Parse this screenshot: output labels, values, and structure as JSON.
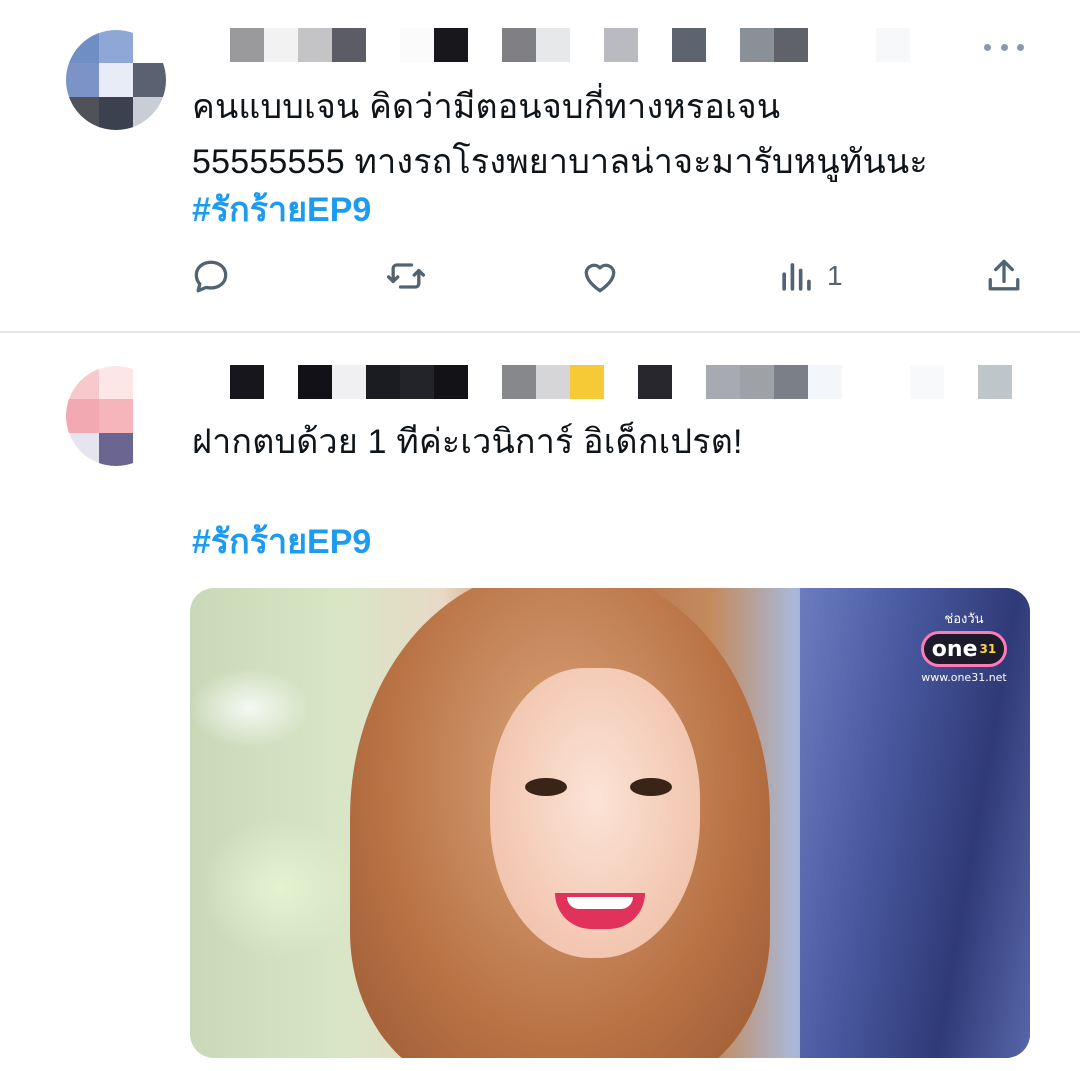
{
  "tweets": [
    {
      "text_lines": [
        "คนแบบเจน คิดว่ามีตอนจบกี่ทางหรอเจน",
        "55555555 ทางรถโรงพยาบาลน่าจะมารับหนูทันนะ"
      ],
      "hashtag": "#รักร้ายEP9",
      "views_count": "1",
      "avatar_pixels": [
        "#6f8fc4",
        "#8ea7d6",
        "#ffffff",
        "#7b93c6",
        "#e8ecf7",
        "#5a6170",
        "#4f5258",
        "#3c4150",
        "#c8cdd6"
      ],
      "name_pixels": [
        "#ffffff",
        "#9a9a9c",
        "#f2f2f2",
        "#c4c4c6",
        "#5c5c66",
        "#ffffff",
        "#fbfbfb",
        "#17171c",
        "#ffffff",
        "#7f7f84",
        "#e6e8ea",
        "#ffffff",
        "#b9bbc0",
        "#ffffff",
        "#5d6470",
        "#ffffff",
        "#8a9098",
        "#5f6268",
        "#ffffff",
        "#ffffff",
        "#f6f8fa",
        "#ffffff",
        "#ffffff",
        "#ffffff"
      ]
    },
    {
      "text_line": "ฝากตบด้วย 1 ทีค่ะเวนิการ์ อิเด็กเปรต!",
      "hashtag": "#รักร้ายEP9",
      "avatar_pixels": [
        "#f6c9cc",
        "#fde6e6",
        "#ffffff",
        "#f2a9b2",
        "#f5b5bb",
        "#ffffff",
        "#e6e4ee",
        "#6b6592",
        "#ffffff"
      ],
      "name_pixels": [
        "#ffffff",
        "#16161c",
        "#ffffff",
        "#111117",
        "#f0f0f2",
        "#1b1b22",
        "#23232a",
        "#121217",
        "#ffffff",
        "#87888c",
        "#d6d6d8",
        "#f6c936",
        "#ffffff",
        "#27272d",
        "#ffffff",
        "#a7aab0",
        "#9ea1a6",
        "#7b8088",
        "#f3f6fa",
        "#ffffff",
        "#ffffff",
        "#f8f9fb",
        "#ffffff",
        "#bfc6ca"
      ],
      "media": {
        "logo_top": "ช่องวัน",
        "logo_badge": "one",
        "logo_badge_sup": "31",
        "logo_url": "www.one31.net"
      }
    }
  ],
  "colors": {
    "hashtag": "#1d9bf0",
    "icon": "#536471",
    "text": "#0f1419",
    "divider": "#e6e8ea"
  },
  "icons": {
    "reply": "speech-bubble",
    "retweet": "two-arrows-loop",
    "like": "heart-outline",
    "views": "bar-chart",
    "share": "upload-arrow",
    "more": "three-dots"
  }
}
